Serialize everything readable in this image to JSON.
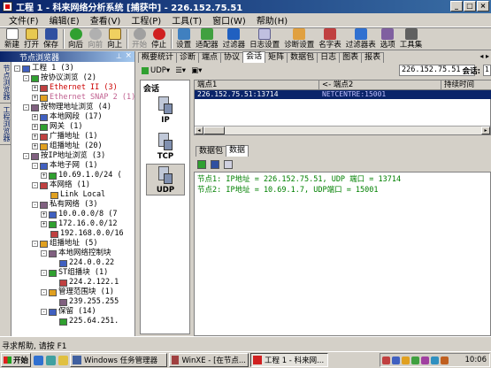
{
  "window": {
    "title": "工程 1 - 科来网络分析系统 [捕获中] - 226.152.75.51",
    "minimize": "_",
    "maximize": "□",
    "close": "×"
  },
  "menu": [
    "文件(F)",
    "编辑(E)",
    "查看(V)",
    "工程(P)",
    "工具(T)",
    "窗口(W)",
    "帮助(H)"
  ],
  "toolbar": {
    "new": "新建",
    "open": "打开",
    "save": "保存",
    "back": "向后",
    "forward": "向前",
    "up": "向上",
    "start": "开始",
    "stop": "停止",
    "settings": "设置",
    "adapter": "适配器",
    "filter": "过滤器",
    "log_settings": "日志设置",
    "diag_settings": "诊断设置",
    "name_table": "名字表",
    "filter_table": "过滤器表",
    "options": "选项",
    "toolbox": "工具集"
  },
  "left_pane": {
    "title": "节点浏览器",
    "vtabs": [
      "节点浏览器",
      "工程浏览器"
    ],
    "tree": [
      {
        "label": "工程 1 (3)",
        "level": 0,
        "expander": "-"
      },
      {
        "label": "按协议浏览 (2)",
        "level": 1,
        "expander": "-"
      },
      {
        "label": "Ethernet II (3)",
        "level": 2,
        "expander": "+",
        "color": "red"
      },
      {
        "label": "Ethernet SNAP 2 (1)",
        "level": 2,
        "expander": "+",
        "color": "pink"
      },
      {
        "label": "按物理地址浏览 (4)",
        "level": 1,
        "expander": "-"
      },
      {
        "label": "本地网段 (17)",
        "level": 2,
        "expander": "+"
      },
      {
        "label": "网关 (1)",
        "level": 2,
        "expander": "+"
      },
      {
        "label": "广播地址 (1)",
        "level": 2,
        "expander": "+"
      },
      {
        "label": "组播地址 (20)",
        "level": 2,
        "expander": "+"
      },
      {
        "label": "按IP地址浏览 (3)",
        "level": 1,
        "expander": "-"
      },
      {
        "label": "本地子网 (1)",
        "level": 2,
        "expander": "-"
      },
      {
        "label": "10.69.1.0/24 (",
        "level": 3,
        "expander": "+"
      },
      {
        "label": "本网络 (1)",
        "level": 2,
        "expander": "-"
      },
      {
        "label": "Link Local",
        "level": 3,
        "expander": ""
      },
      {
        "label": "私有网络 (3)",
        "level": 2,
        "expander": "-"
      },
      {
        "label": "10.0.0.0/8 (7",
        "level": 3,
        "expander": "+"
      },
      {
        "label": "172.16.0.0/12",
        "level": 3,
        "expander": "+"
      },
      {
        "label": "192.168.0.0/16",
        "level": 3,
        "expander": ""
      },
      {
        "label": "组播地址 (5)",
        "level": 2,
        "expander": "-"
      },
      {
        "label": "本地网络控制块",
        "level": 3,
        "expander": "-"
      },
      {
        "label": "224.0.0.22",
        "level": 4,
        "expander": ""
      },
      {
        "label": "ST组播块 (1)",
        "level": 3,
        "expander": "-"
      },
      {
        "label": "224.2.122.1",
        "level": 4,
        "expander": ""
      },
      {
        "label": "管理范围块 (1)",
        "level": 3,
        "expander": "-"
      },
      {
        "label": "239.255.255",
        "level": 4,
        "expander": ""
      },
      {
        "label": "保留 (14)",
        "level": 3,
        "expander": "-"
      },
      {
        "label": "225.64.251.",
        "level": 4,
        "expander": ""
      }
    ]
  },
  "tabs": [
    "概要统计",
    "诊断",
    "端点",
    "协议",
    "会话",
    "矩阵",
    "数据包",
    "日志",
    "图表",
    "报表"
  ],
  "active_tab": "会话",
  "session_toolbar": {
    "udp_dropdown": "UDP",
    "address": "226.152.75.51",
    "session_label": "会话:",
    "session_num": "1"
  },
  "protocol_panel": {
    "header": "会话",
    "items": [
      "IP",
      "TCP",
      "UDP"
    ],
    "selected": "UDP"
  },
  "session_grid": {
    "columns": [
      "端点1",
      "<- 端点2",
      "持续时间"
    ],
    "rows": [
      {
        "endpoint1": "226.152.75.51:13714",
        "endpoint2": "NETCENTRE:15001",
        "duration": ""
      }
    ]
  },
  "bottom_tabs": [
    "数据包",
    "数据"
  ],
  "active_bottom_tab": "数据",
  "data_lines": [
    "节点1: IP地址 = 226.152.75.51, UDP 端口 = 13714",
    "节点2: IP地址 = 10.69.1.7, UDP端口 = 15001"
  ],
  "status_text": "寻求帮助, 请按 F1",
  "taskbar": {
    "start": "开始",
    "tasks": [
      {
        "label": "Windows 任务管理器",
        "active": false
      },
      {
        "label": "WinXE - [在节点...",
        "active": false
      },
      {
        "label": "工程 1 - 科来网...",
        "active": true
      }
    ],
    "clock": "10:06"
  },
  "colors": {
    "title_start": "#0a246a",
    "title_end": "#3a6ea5",
    "selection": "#0a246a",
    "data_text": "#008000",
    "tree_red": "#c00000"
  }
}
